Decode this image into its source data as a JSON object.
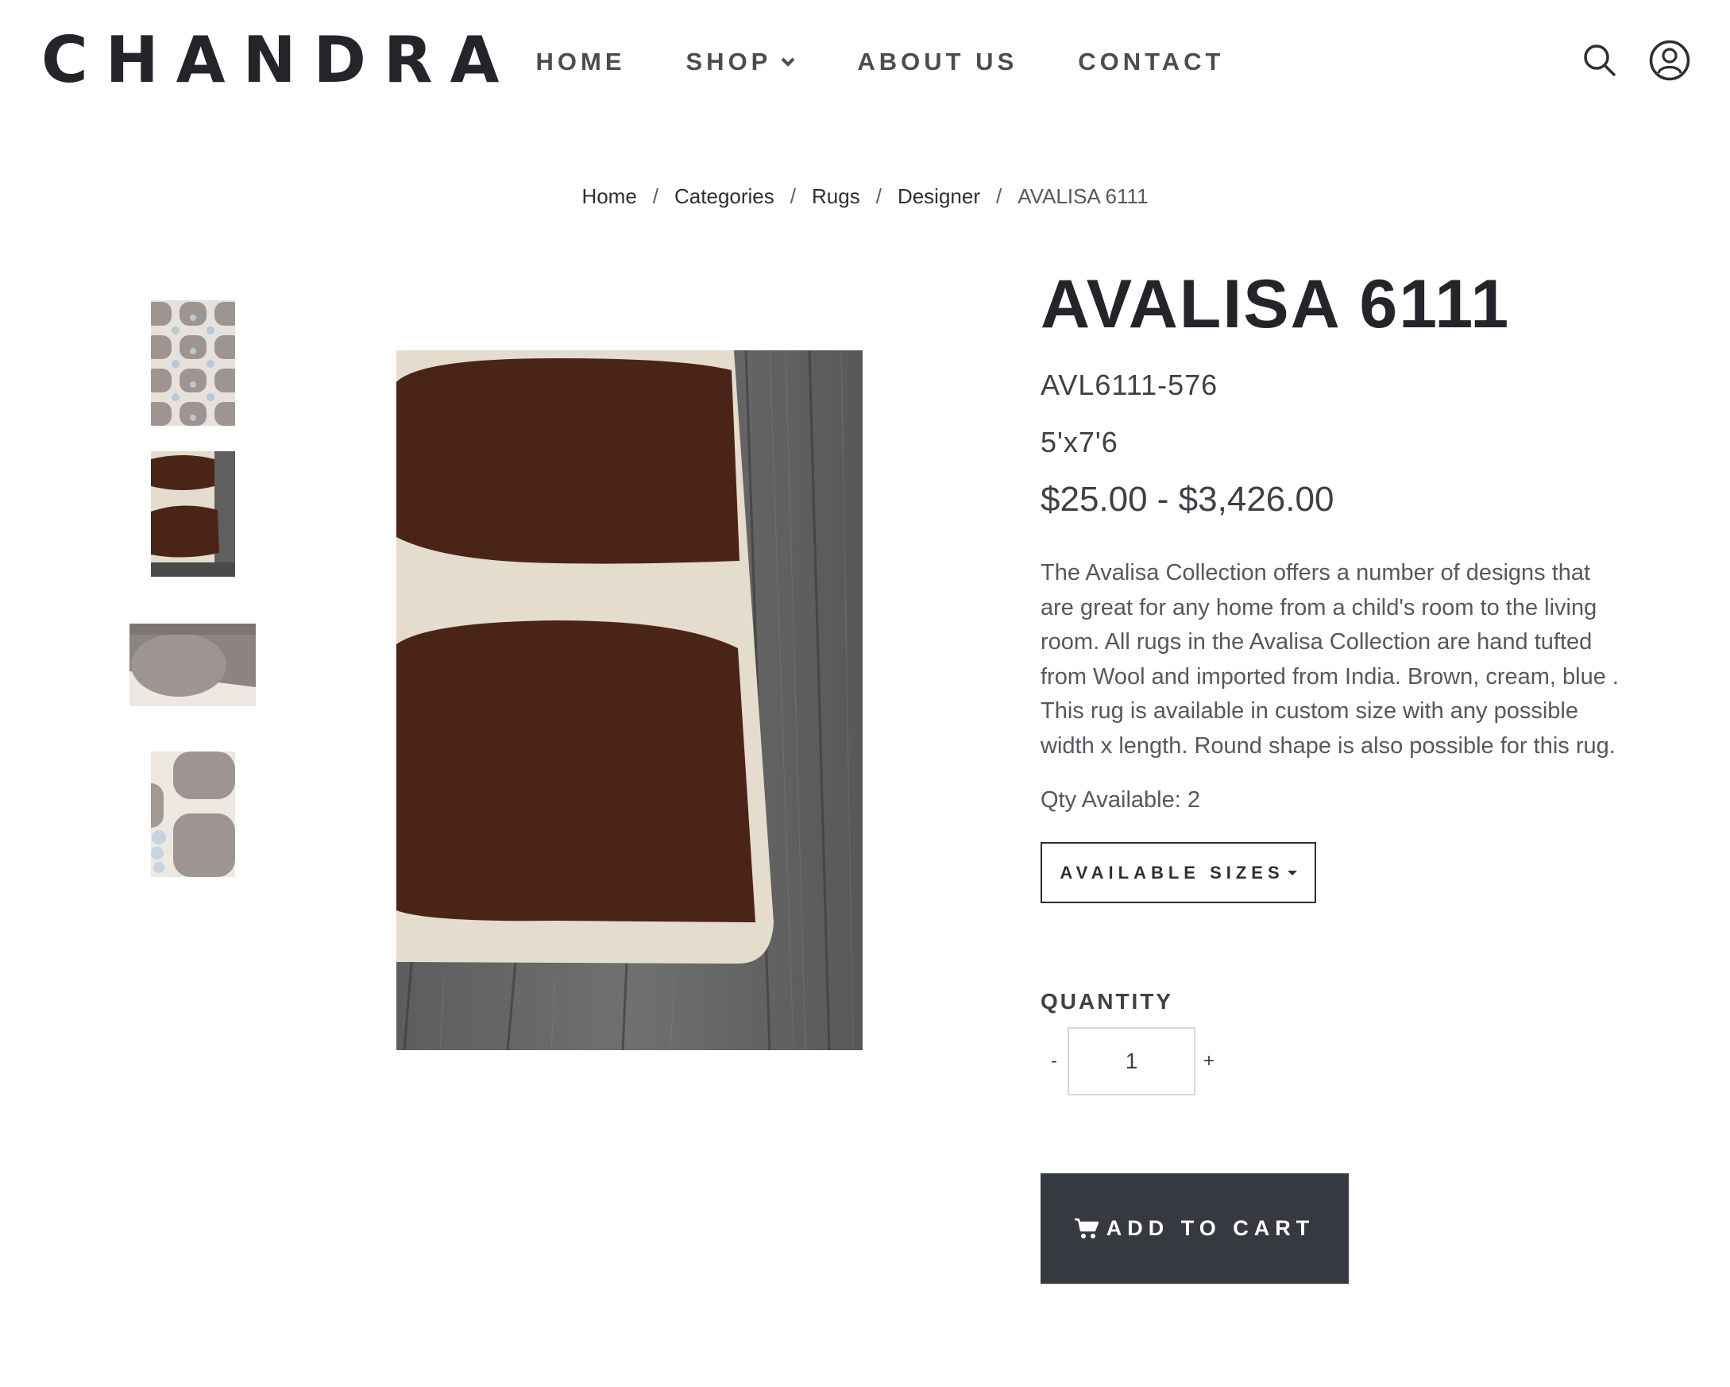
{
  "header": {
    "logo": "CHANDRA",
    "nav": {
      "home": "HOME",
      "shop": "SHOP",
      "about": "ABOUT US",
      "contact": "CONTACT"
    },
    "icons": [
      "search-icon",
      "user-account-icon"
    ]
  },
  "breadcrumb": {
    "home": "Home",
    "categories": "Categories",
    "rugs": "Rugs",
    "designer": "Designer",
    "current": "AVALISA 6111",
    "separator": "/"
  },
  "product": {
    "title": "AVALISA 6111",
    "sku": "AVL6111-576",
    "size": "5'x7'6",
    "price": "$25.00 - $3,426.00",
    "description": "The Avalisa Collection offers a number of designs that are great for any home from a child's room to the living room. All rugs in the Avalisa Collection are hand tufted from Wool and imported from India. Brown, cream, blue . This rug is available in custom size with any possible width x length. Round shape is also possible for this rug.",
    "qty_available": "Qty Available: 2",
    "sizes_button": "AVAILABLE SIZES",
    "quantity_label": "QUANTITY",
    "quantity_minus": "-",
    "quantity_plus": "+",
    "quantity_value": "1",
    "add_to_cart": "ADD TO CART"
  },
  "colors": {
    "text_dark": "#23252a",
    "text_body": "#55585d",
    "cart_button_bg": "#363a40",
    "rug_brown": "#4b2418",
    "rug_cream": "#e4dccd",
    "wood_gray": "#6a6a6a",
    "rug_taupe": "#9e9593",
    "rug_blue": "#b8c8d8"
  }
}
